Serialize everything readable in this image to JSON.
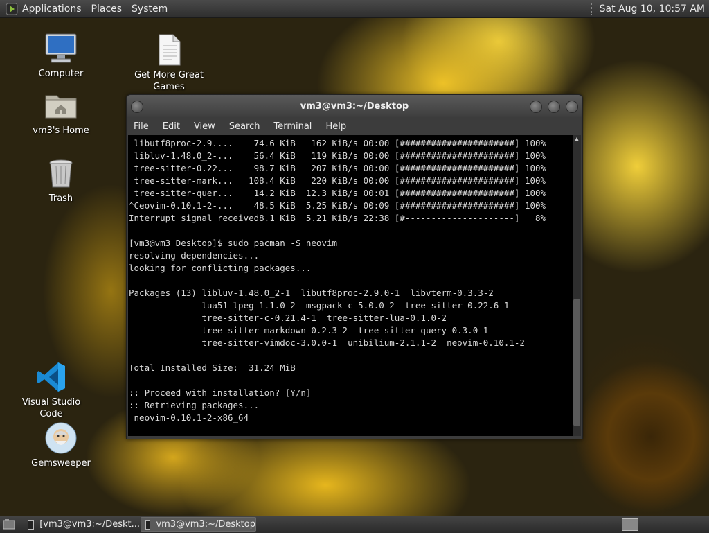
{
  "top_panel": {
    "menus": [
      "Applications",
      "Places",
      "System"
    ],
    "clock": "Sat Aug 10, 10:57 AM"
  },
  "desktop_icons": {
    "computer": "Computer",
    "home": "vm3's Home",
    "trash": "Trash",
    "games": "Get More Great Games",
    "vscode": "Visual Studio Code",
    "gemsweeper": "Gemsweeper"
  },
  "terminal": {
    "title": "vm3@vm3:~/Desktop",
    "menu": [
      "File",
      "Edit",
      "View",
      "Search",
      "Terminal",
      "Help"
    ],
    "lines": [
      " libutf8proc-2.9....    74.6 KiB   162 KiB/s 00:00 [######################] 100%",
      " libluv-1.48.0_2-...    56.4 KiB   119 KiB/s 00:00 [######################] 100%",
      " tree-sitter-0.22...    98.7 KiB   207 KiB/s 00:00 [######################] 100%",
      " tree-sitter-mark...   108.4 KiB   220 KiB/s 00:00 [######################] 100%",
      " tree-sitter-quer...    14.2 KiB  12.3 KiB/s 00:01 [######################] 100%",
      "^Ceovim-0.10.1-2-...    48.5 KiB  5.25 KiB/s 00:09 [######################] 100%",
      "Interrupt signal received8.1 KiB  5.21 KiB/s 22:38 [#---------------------]   8%",
      "",
      "[vm3@vm3 Desktop]$ sudo pacman -S neovim",
      "resolving dependencies...",
      "looking for conflicting packages...",
      "",
      "Packages (13) libluv-1.48.0_2-1  libutf8proc-2.9.0-1  libvterm-0.3.3-2",
      "              lua51-lpeg-1.1.0-2  msgpack-c-5.0.0-2  tree-sitter-0.22.6-1",
      "              tree-sitter-c-0.21.4-1  tree-sitter-lua-0.1.0-2",
      "              tree-sitter-markdown-0.2.3-2  tree-sitter-query-0.3.0-1",
      "              tree-sitter-vimdoc-3.0.0-1  unibilium-2.1.1-2  neovim-0.10.1-2",
      "",
      "Total Installed Size:  31.24 MiB",
      "",
      ":: Proceed with installation? [Y/n]",
      ":: Retrieving packages...",
      " neovim-0.10.1-2-x86_64"
    ]
  },
  "taskbar": {
    "task1": "[vm3@vm3:~/Deskt...",
    "task2": "vm3@vm3:~/Desktop"
  }
}
